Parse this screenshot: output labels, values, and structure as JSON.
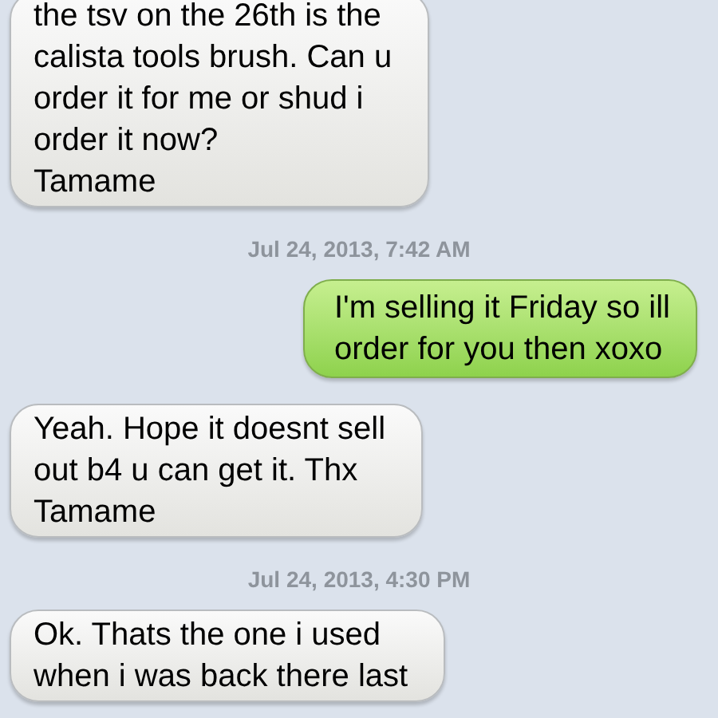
{
  "messages": [
    {
      "kind": "received",
      "lines": [
        "the tsv on the 26th is the",
        "calista tools brush. Can u",
        "order it for me or shud i",
        "order it now?",
        "Tamame"
      ]
    },
    {
      "kind": "timestamp",
      "text": "Jul 24, 2013, 7:42 AM"
    },
    {
      "kind": "sent",
      "lines": [
        "I'm selling it Friday so ill",
        "order for you then xoxo"
      ]
    },
    {
      "kind": "received",
      "lines": [
        "Yeah. Hope it doesnt sell",
        "out b4 u can get it. Thx",
        "Tamame"
      ]
    },
    {
      "kind": "timestamp",
      "text": "Jul 24, 2013, 4:30 PM"
    },
    {
      "kind": "received",
      "lines": [
        "Ok. Thats the one i used",
        "when i was back there last"
      ]
    }
  ]
}
